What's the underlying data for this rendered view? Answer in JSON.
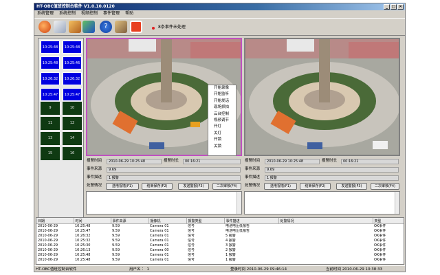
{
  "window": {
    "title": "HT-OBC值班控制台软件 V1.0.10.0120"
  },
  "menu": [
    "系统管理",
    "系统控制",
    "视频控制",
    "事件管理",
    "帮助"
  ],
  "toolbar": {
    "icons": [
      "alarm-icon",
      "edit-icon",
      "box-icon",
      "users-icon",
      "help-icon",
      "tools-icon",
      "exit-icon"
    ],
    "alarm_text": "8条事件未处理"
  },
  "grid": [
    [
      "10:25:48",
      "10:25:48"
    ],
    [
      "10:25:48",
      "10:25:46"
    ],
    [
      "10:26:32",
      "10:26:32"
    ],
    [
      "10:25:47",
      "10:25:47"
    ],
    [
      "9",
      "10"
    ],
    [
      "11",
      "12"
    ],
    [
      "13",
      "14"
    ],
    [
      "15",
      "16"
    ]
  ],
  "context_menu": [
    "开始录像",
    "开始监听",
    "开始发话",
    "现场抓拍",
    "云台控制",
    "视频调节",
    "开灯",
    "关灯",
    "开锁",
    "关锁"
  ],
  "panels": [
    {
      "alarm_time_label": "报警时间",
      "alarm_time": "2010-06-29 10:25:48",
      "duration_label": "报警时长",
      "duration": "00:16:21",
      "source_label": "事件来源",
      "source": "9.69",
      "desc_label": "事件描述",
      "desc": "1 报警",
      "handle_label": "处警情况",
      "buttons": [
        "选电视墙(F1)",
        "结束保存(F2)",
        "发送警报(F3)",
        "二次审核(F4)"
      ]
    },
    {
      "alarm_time_label": "报警时间",
      "alarm_time": "2010-06-29 10:25:48",
      "duration_label": "报警时长",
      "duration": "00:16:21",
      "source_label": "事件来源",
      "source": "9.69",
      "desc_label": "事件描述",
      "desc": "1 报警",
      "handle_label": "处警情况",
      "buttons": [
        "选电视墙(F1)",
        "结束保存(F2)",
        "发送警报(F3)",
        "二次审核(F4)"
      ]
    }
  ],
  "log": {
    "columns": [
      "日期",
      "时间",
      "事件来源",
      "摄像机",
      "报警类型",
      "事件描述",
      "处警情况",
      "类型"
    ],
    "rows": [
      [
        "2010-06-29",
        "10:25:48",
        "9.59",
        "Camera 01",
        "信号",
        "电池电压低报告",
        "",
        "OK事件"
      ],
      [
        "2010-06-29",
        "10:25:47",
        "9.59",
        "Camera 01",
        "信号",
        "电池电压低报告",
        "",
        "OK事件"
      ],
      [
        "2010-06-29",
        "10:26:32",
        "9.59",
        "Camera 01",
        "信号",
        "5 报警",
        "",
        "OK事件"
      ],
      [
        "2010-06-29",
        "10:25:32",
        "9.59",
        "Camera 01",
        "信号",
        "4 报警",
        "",
        "OK事件"
      ],
      [
        "2010-06-29",
        "10:25:30",
        "9.59",
        "Camera 01",
        "信号",
        "3 报警",
        "",
        "OK事件"
      ],
      [
        "2010-06-29",
        "10:26:13",
        "9.59",
        "Camera 00",
        "信号",
        "2 报警",
        "",
        "OK事件"
      ],
      [
        "2010-06-29",
        "10:25:48",
        "9.59",
        "Camera 01",
        "信号",
        "1 报警",
        "",
        "OK事件"
      ],
      [
        "2010-06-29",
        "10:25:48",
        "9.59",
        "Camera 01",
        "信号",
        "1 报警",
        "",
        "OK事件"
      ]
    ]
  },
  "status": {
    "app": "HT-OBC值班控制台软件",
    "user": "用户名 ： 1",
    "login": "登录时间  2010-06-29 09:46:14",
    "now": "当前时间  2010-06-29 10:38:33"
  }
}
